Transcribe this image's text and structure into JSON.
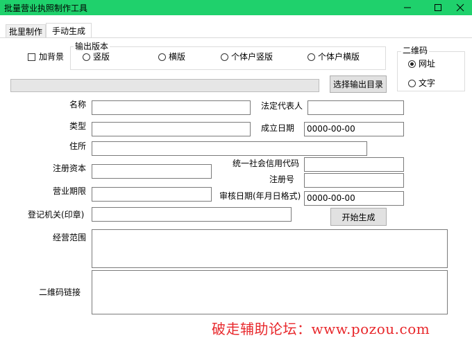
{
  "window": {
    "title": "批量营业执照制作工具"
  },
  "tabs": [
    {
      "label": "批里制作",
      "active": false
    },
    {
      "label": "手动生成",
      "active": true
    }
  ],
  "options": {
    "background_checkbox_label": "加背景",
    "background_checked": false,
    "layout_group_title": "输出版本",
    "layout_choices": [
      "竖版",
      "横版",
      "个体户竖版",
      "个体户横版"
    ],
    "layout_selected": "",
    "qr_group_title": "二维码",
    "qr_choices": [
      "网址",
      "文字"
    ],
    "qr_selected": "网址",
    "output_path": "",
    "select_output_button": "选择输出目录"
  },
  "form": {
    "name_label": "名称",
    "name_value": "",
    "legal_rep_label": "法定代表人",
    "legal_rep_value": "",
    "type_label": "类型",
    "type_value": "",
    "established_label": "成立日期",
    "established_value": "0000-00-00",
    "address_label": "住所",
    "address_value": "",
    "capital_label": "注册资本",
    "capital_value": "",
    "credit_code_label": "统一社会信用代码",
    "credit_code_value": "",
    "reg_no_label": "注册号",
    "reg_no_value": "",
    "term_label": "营业期限",
    "term_value": "",
    "approval_date_label": "审核日期(年月日格式)",
    "approval_date_value": "0000-00-00",
    "authority_label": "登记机关(印章)",
    "authority_value": "",
    "generate_button": "开始生成",
    "scope_label": "经营范围",
    "scope_value": "",
    "qr_link_label": "二维码链接",
    "qr_link_value": ""
  },
  "watermark": {
    "text": "破走辅助论坛：www.pozou.com",
    "color": "#e8272b"
  },
  "colors": {
    "titlebar": "#1fd16c",
    "button_face": "#e1e1e1"
  }
}
